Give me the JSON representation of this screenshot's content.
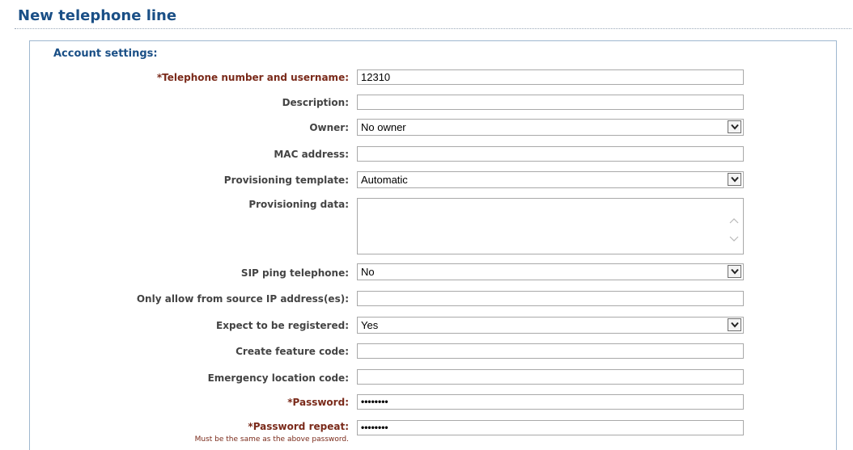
{
  "page": {
    "title": "New telephone line"
  },
  "section": {
    "title": "Account settings:"
  },
  "fields": {
    "telephone_number": {
      "label": "*Telephone number and username:",
      "value": "12310"
    },
    "description": {
      "label": "Description:",
      "value": ""
    },
    "owner": {
      "label": "Owner:",
      "value": "No owner"
    },
    "mac_address": {
      "label": "MAC address:",
      "value": ""
    },
    "provisioning_template": {
      "label": "Provisioning template:",
      "value": "Automatic"
    },
    "provisioning_data": {
      "label": "Provisioning data:",
      "value": ""
    },
    "sip_ping": {
      "label": "SIP ping telephone:",
      "value": "No"
    },
    "source_ip": {
      "label": "Only allow from source IP address(es):",
      "value": ""
    },
    "expect_registered": {
      "label": "Expect to be registered:",
      "value": "Yes"
    },
    "feature_code": {
      "label": "Create feature code:",
      "value": ""
    },
    "emergency_code": {
      "label": "Emergency location code:",
      "value": ""
    },
    "password": {
      "label": "*Password:",
      "value": "••••••••"
    },
    "password_repeat": {
      "label": "*Password repeat:",
      "value": "••••••••",
      "hint": "Must be the same as the above password."
    }
  },
  "colors": {
    "title": "#1a4f86",
    "required_label": "#7a2a1a",
    "label": "#444444",
    "panel_border": "#9fb8cf"
  },
  "icons": {
    "dropdown": "chevron-down-icon",
    "scroll_up": "scroll-up-icon",
    "scroll_down": "scroll-down-icon"
  }
}
